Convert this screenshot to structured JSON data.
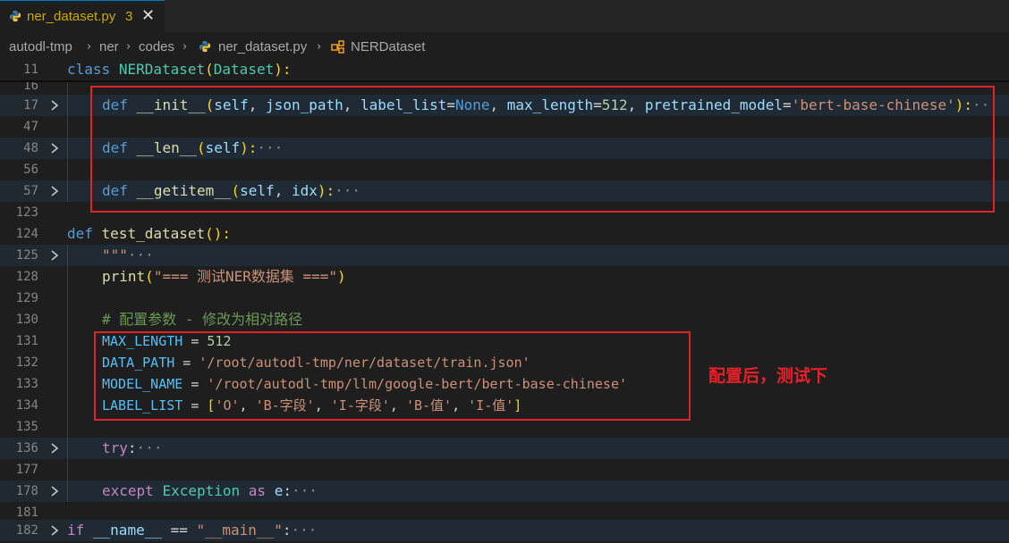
{
  "tab": {
    "filename": "ner_dataset.py",
    "problem_count": "3",
    "close_glyph": "✕",
    "icon": "python-icon"
  },
  "breadcrumb": {
    "items": [
      "autodl-tmp",
      "ner",
      "codes",
      "ner_dataset.py",
      "NERDataset"
    ],
    "separator": "›"
  },
  "lines": {
    "l11": {
      "num": "11",
      "kw": "class",
      "name": "NERDataset",
      "open": "(",
      "base": "Dataset",
      "close": "):"
    },
    "l16": {
      "num": "16"
    },
    "l17": {
      "num": "17",
      "kw": "def",
      "name": "__init__",
      "open": "(",
      "p1": "self",
      "c1": ", ",
      "p2": "json_path",
      "c2": ", ",
      "p3": "label_list",
      "eq1": "=",
      "v3": "None",
      "c3": ", ",
      "p4": "max_length",
      "eq2": "=",
      "v4": "512",
      "c4": ", ",
      "p5": "pretrained_model",
      "eq3": "=",
      "v5": "'bert-base-chinese'",
      "close": "):",
      "fold": "···"
    },
    "l47": {
      "num": "47"
    },
    "l48": {
      "num": "48",
      "kw": "def",
      "name": "__len__",
      "open": "(",
      "p1": "self",
      "close": "):",
      "fold": "···"
    },
    "l56": {
      "num": "56"
    },
    "l57": {
      "num": "57",
      "kw": "def",
      "name": "__getitem__",
      "open": "(",
      "p1": "self",
      "c1": ", ",
      "p2": "idx",
      "close": "):",
      "fold": "···"
    },
    "l123": {
      "num": "123"
    },
    "l124": {
      "num": "124",
      "kw": "def",
      "name": "test_dataset",
      "open": "(",
      "close": "):"
    },
    "l125": {
      "num": "125",
      "str": "\"\"\"",
      "fold": "···"
    },
    "l128": {
      "num": "128",
      "fn": "print",
      "open": "(",
      "str": "\"=== 测试NER数据集 ===\"",
      "close": ")"
    },
    "l129": {
      "num": "129"
    },
    "l130": {
      "num": "130",
      "cmt": "# 配置参数 - 修改为相对路径"
    },
    "l131": {
      "num": "131",
      "name": "MAX_LENGTH",
      "eq": " = ",
      "val": "512"
    },
    "l132": {
      "num": "132",
      "name": "DATA_PATH",
      "eq": " = ",
      "val": "'/root/autodl-tmp/ner/dataset/train.json'"
    },
    "l133": {
      "num": "133",
      "name": "MODEL_NAME",
      "eq": " = ",
      "val": "'/root/autodl-tmp/llm/google-bert/bert-base-chinese'"
    },
    "l134": {
      "num": "134",
      "name": "LABEL_LIST",
      "eq": " = ",
      "open": "[",
      "s1": "'O'",
      "c1": ", ",
      "s2": "'B-字段'",
      "c2": ", ",
      "s3": "'I-字段'",
      "c3": ", ",
      "s4": "'B-值'",
      "c4": ", ",
      "s5": "'I-值'",
      "close": "]"
    },
    "l135": {
      "num": "135"
    },
    "l136": {
      "num": "136",
      "kw": "try",
      "colon": ":",
      "fold": "···"
    },
    "l177": {
      "num": "177"
    },
    "l178": {
      "num": "178",
      "kw": "except",
      "cls": "Exception",
      "as": "as",
      "var": "e",
      "colon": ":",
      "fold": "···"
    },
    "l181": {
      "num": "181"
    },
    "l182": {
      "num": "182",
      "kw": "if",
      "name": "__name__",
      "eq": " == ",
      "str": "\"__main__\"",
      "colon": ":",
      "fold": "···"
    }
  },
  "annotation": {
    "text": "配置后，测试下",
    "color": "#e8202a"
  },
  "colors": {
    "keyword": "#569cd6",
    "function": "#dcdcaa",
    "class": "#4ec9b0",
    "param": "#9cdcfe",
    "string": "#ce9178",
    "number": "#b5cea8",
    "comment": "#6a9955",
    "constant": "#4fc1ff",
    "highlight_box": "#e0222a"
  }
}
